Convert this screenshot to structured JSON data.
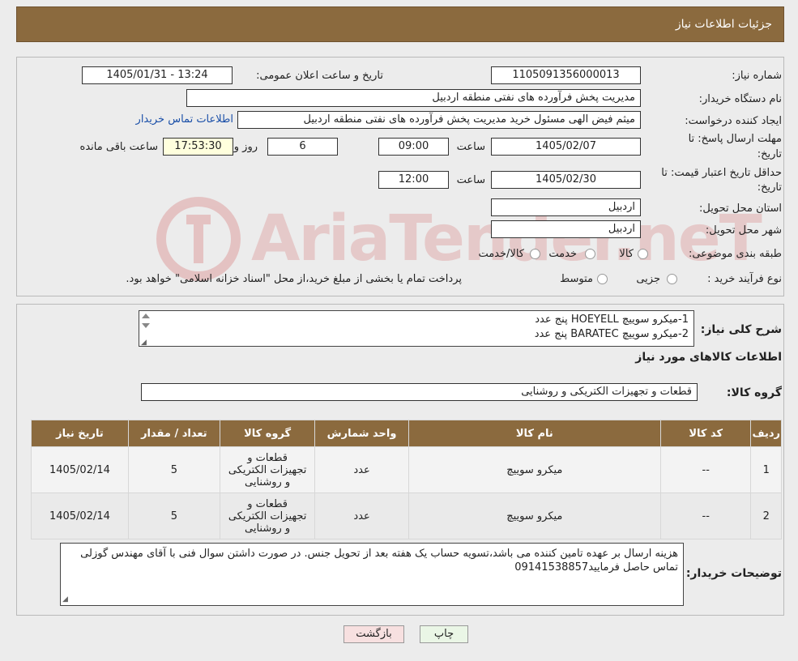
{
  "header": {
    "title": "جزئیات اطلاعات نیاز"
  },
  "form": {
    "need_number_label": "شماره نیاز:",
    "need_number": "1105091356000013",
    "announce_label": "تاریخ و ساعت اعلان عمومی:",
    "announce_value": "1405/01/31 - 13:24",
    "buyer_org_label": "نام دستگاه خریدار:",
    "buyer_org": "مدیریت پخش فرآورده های نفتی منطقه اردبیل",
    "creator_label": "ایجاد کننده درخواست:",
    "creator": "میثم فیض الهی مسئول خرید مدیریت پخش فرآورده های نفتی منطقه اردبیل",
    "contact_link": "اطلاعات تماس خریدار",
    "deadline_label_1": "مهلت ارسال پاسخ: تا",
    "deadline_label_2": "تاریخ:",
    "deadline_date": "1405/02/07",
    "time_label": "ساعت",
    "deadline_time": "09:00",
    "days": "6",
    "days_suffix": "روز و",
    "remaining_time": "17:53:30",
    "remaining_suffix": "ساعت باقی مانده",
    "price_label_1": "حداقل تاریخ اعتبار قیمت: تا",
    "price_label_2": "تاریخ:",
    "price_date": "1405/02/30",
    "price_time": "12:00",
    "province_label": "استان محل تحویل:",
    "province": "اردبیل",
    "city_label": "شهر محل تحویل:",
    "city": "اردبیل",
    "category_label": "طبقه بندی موضوعی:",
    "category_options": [
      "کالا",
      "خدمت",
      "کالا/خدمت"
    ],
    "process_label": "نوع فرآیند خرید :",
    "process_options": [
      "جزیی",
      "متوسط"
    ],
    "process_note": "پرداخت تمام یا بخشی از مبلغ خرید،از محل \"اسناد خزانه اسلامی\" خواهد بود."
  },
  "summary": {
    "label": "شرح کلی نیاز:",
    "line1": "1-میکرو سوییچ HOEYELL پنج عدد",
    "line2": "2-میکرو سوییچ BARATEC پنج عدد",
    "goods_info_title": "اطلاعات کالاهای مورد نیاز",
    "goods_group_label": "گروه کالا:",
    "goods_group": "قطعات و تجهیزات الکتریکی و روشنایی"
  },
  "table": {
    "headers": [
      "ردیف",
      "کد کالا",
      "نام کالا",
      "واحد شمارش",
      "گروه کالا",
      "تعداد / مقدار",
      "تاریخ نیاز"
    ],
    "rows": [
      [
        "1",
        "--",
        "میکرو سوییچ",
        "عدد",
        "قطعات و تجهیزات الکتریکی و روشنایی",
        "5",
        "1405/02/14"
      ],
      [
        "2",
        "--",
        "میکرو سوییچ",
        "عدد",
        "قطعات و تجهیزات الکتریکی و روشنایی",
        "5",
        "1405/02/14"
      ]
    ]
  },
  "notes": {
    "label": "توضیحات خریدار:",
    "text": "هزینه ارسال بر عهده تامین کننده می باشد،تسویه حساب یک هفته بعد از تحویل جنس. در صورت داشتن سوال فنی با آقای مهندس گوزلی تماس حاصل فرمایید09141538857"
  },
  "buttons": {
    "print": "چاپ",
    "back": "بازگشت"
  },
  "watermark": {
    "text": "AriaTender.neT"
  },
  "colors": {
    "header_bg": "#8b6a3e",
    "link": "#1a4fa8",
    "back_btn_bg": "#f7e0e0",
    "print_btn_bg": "#eaf6e6"
  }
}
